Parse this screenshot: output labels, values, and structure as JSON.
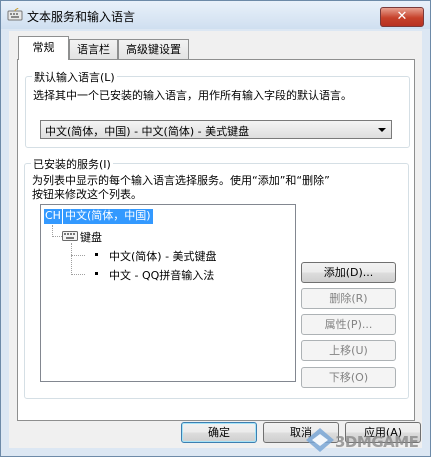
{
  "window": {
    "title": "文本服务和输入语言",
    "close_glyph": "✕"
  },
  "tabs": [
    {
      "label": "常规"
    },
    {
      "label": "语言栏"
    },
    {
      "label": "高级键设置"
    }
  ],
  "default_language": {
    "group_label": "默认输入语言(L)",
    "description": "选择其中一个已安装的输入语言，用作所有输入字段的默认语言。",
    "selected": "中文(简体，中国) - 中文(简体) - 美式键盘"
  },
  "installed_services": {
    "group_label": "已安装的服务(I)",
    "description_line1": "为列表中显示的每个输入语言选择服务。使用“添加”和“删除”",
    "description_line2": "按钮来修改这个列表。",
    "tree": {
      "lang_badge": "CH",
      "language": "中文(简体，中国)",
      "category": "键盘",
      "items": [
        "中文(简体) - 美式键盘",
        "中文 - QQ拼音输入法"
      ]
    },
    "buttons": {
      "add": "添加(D)...",
      "remove": "删除(R)",
      "properties": "属性(P)...",
      "move_up": "上移(U)",
      "move_down": "下移(O)"
    }
  },
  "footer": {
    "ok": "确定",
    "cancel": "取消",
    "apply": "应用(A)"
  },
  "watermark": "3DMGAME"
}
